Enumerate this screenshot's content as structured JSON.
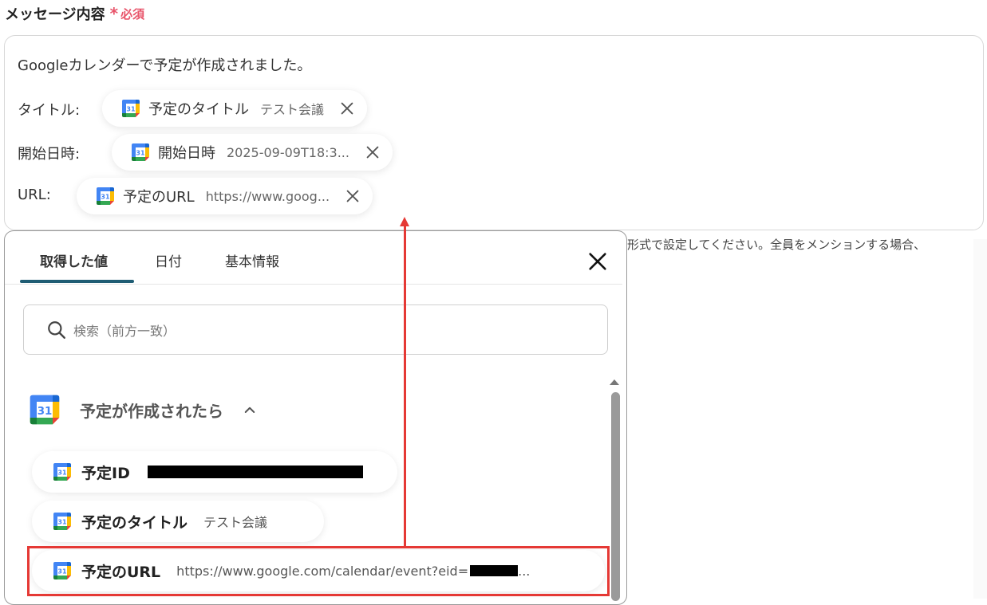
{
  "field": {
    "label": "メッセージ内容",
    "required_label": "必須",
    "required_mark": "*"
  },
  "message": {
    "line1": "Googleカレンダーで予定が作成されました。",
    "rows": [
      {
        "label": "タイトル:",
        "chip_name": "予定のタイトル",
        "chip_value": "テスト会議"
      },
      {
        "label": "開始日時:",
        "chip_name": "開始日時",
        "chip_value": "2025-09-09T18:3..."
      },
      {
        "label": "URL:",
        "chip_name": "予定のURL",
        "chip_value": "https://www.goog..."
      }
    ]
  },
  "hint_text": "形式で設定してください。全員をメンションする場合、",
  "panel": {
    "tabs": [
      "取得した値",
      "日付",
      "基本情報"
    ],
    "active_tab": "取得した値",
    "search_placeholder": "検索（前方一致）",
    "group_title": "予定が作成されたら",
    "items": [
      {
        "name": "予定ID",
        "value": ""
      },
      {
        "name": "予定のタイトル",
        "value": "テスト会議"
      },
      {
        "name": "予定のURL",
        "value": "https://www.google.com/calendar/event?eid=",
        "value_suffix": "..."
      }
    ]
  },
  "colors": {
    "required": "#e8546a",
    "tab_underline": "#1f5d74",
    "highlight": "#e53935"
  },
  "icons": [
    "google-calendar-icon",
    "close-icon",
    "search-icon",
    "chevron-up-icon"
  ]
}
